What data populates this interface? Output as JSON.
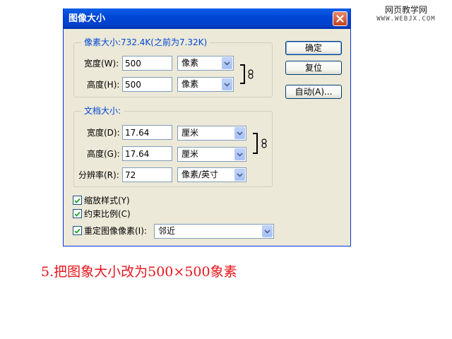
{
  "watermark": {
    "line1": "网页教学网",
    "line2": "WWW.WEBJX.COM"
  },
  "dialog": {
    "title": "图像大小",
    "pixel_dimensions": {
      "legend": "像素大小:732.4K(之前为7.32K)",
      "width_label": "宽度(W):",
      "width_value": "500",
      "width_unit": "像素",
      "height_label": "高度(H):",
      "height_value": "500",
      "height_unit": "像素"
    },
    "document_size": {
      "legend": "文档大小:",
      "width_label": "宽度(D):",
      "width_value": "17.64",
      "width_unit": "厘米",
      "height_label": "高度(G):",
      "height_value": "17.64",
      "height_unit": "厘米",
      "resolution_label": "分辨率(R):",
      "resolution_value": "72",
      "resolution_unit": "像素/英寸"
    },
    "buttons": {
      "ok": "确定",
      "reset": "复位",
      "auto": "自动(A)..."
    },
    "checkboxes": {
      "scale_styles": {
        "label": "缩放样式(Y)",
        "checked": true
      },
      "constrain": {
        "label": "约束比例(C)",
        "checked": true
      },
      "resample": {
        "label": "重定图像像素(I):",
        "checked": true
      }
    },
    "resample_method": "邻近"
  },
  "caption": "5.把图象大小改为500×500象素",
  "colors": {
    "title_bar": "#0046d5",
    "legend_text": "#0046d5",
    "caption": "#e8151b",
    "dialog_bg": "#ece9d8"
  }
}
